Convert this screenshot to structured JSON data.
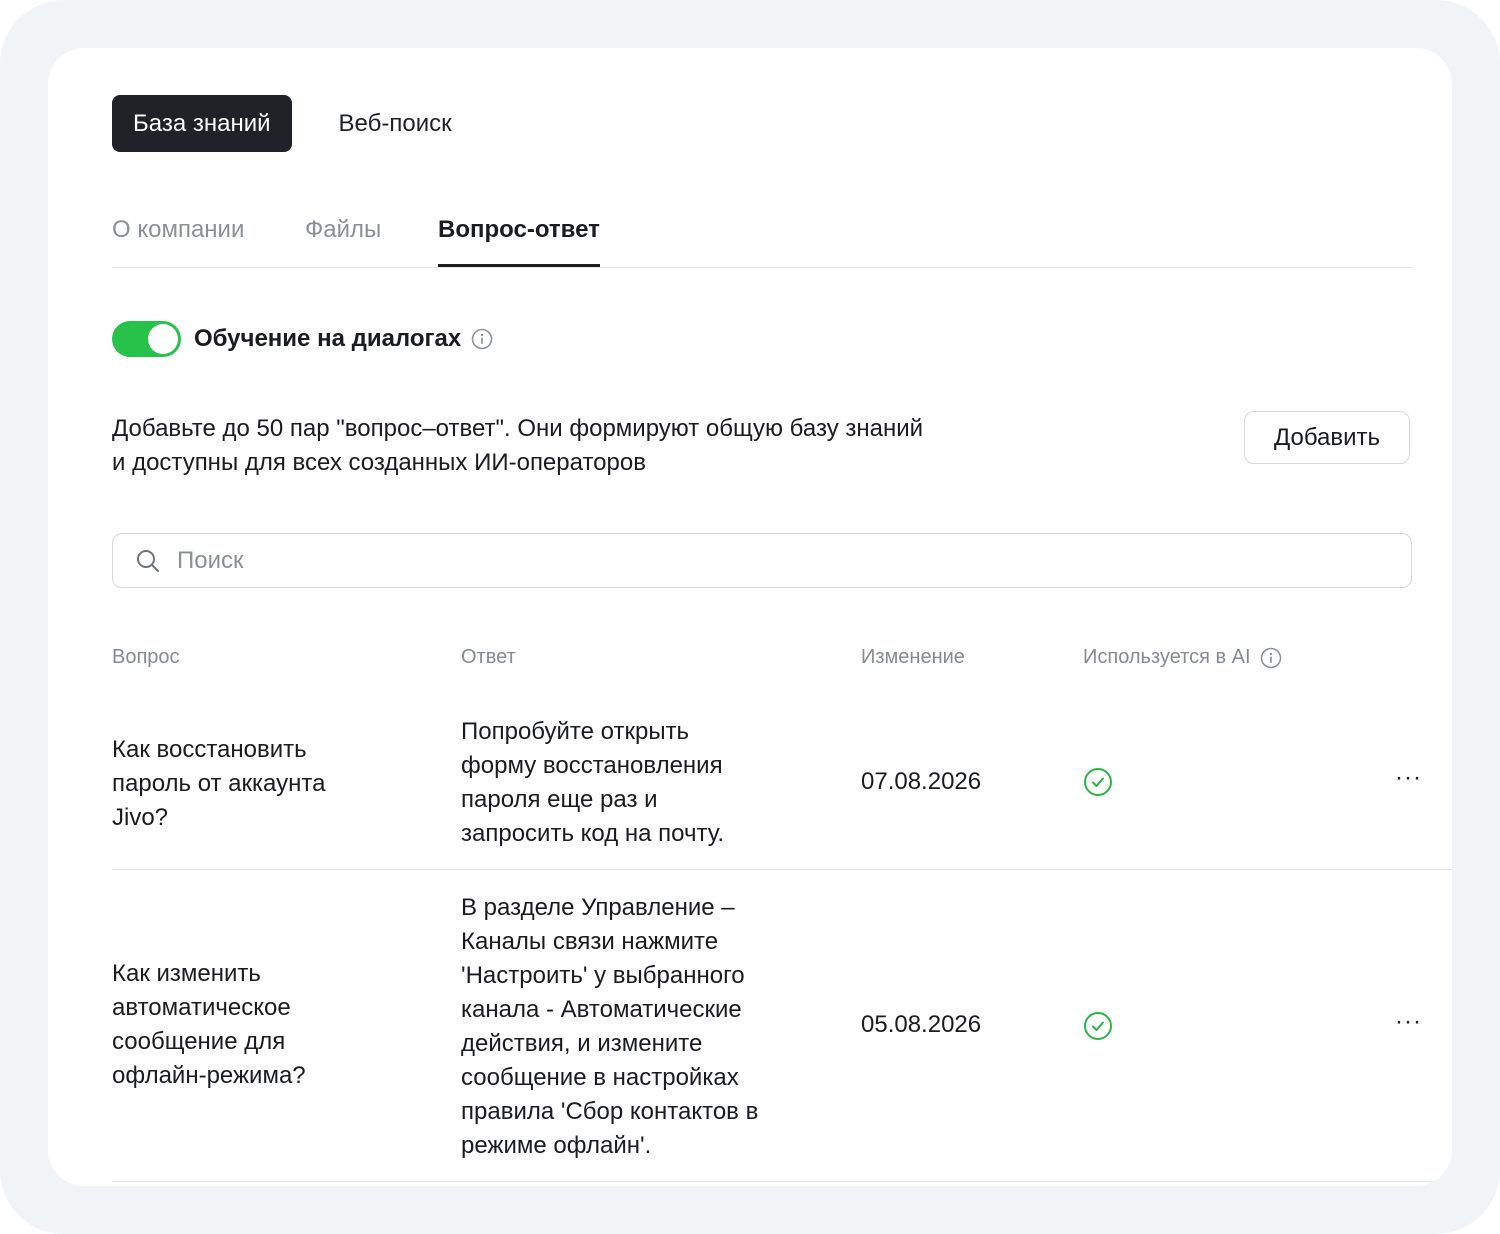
{
  "top_tabs": [
    {
      "label": "База знаний",
      "active": true
    },
    {
      "label": "Веб-поиск",
      "active": false
    }
  ],
  "sub_tabs": [
    {
      "label": "О компании",
      "active": false
    },
    {
      "label": "Файлы",
      "active": false
    },
    {
      "label": "Вопрос-ответ",
      "active": true
    }
  ],
  "training": {
    "label": "Обучение на диалогах",
    "enabled": true
  },
  "description": {
    "line1": "Добавьте до 50 пар \"вопрос–ответ\". Они формируют общую базу знаний",
    "line2": "и доступны для всех созданных ИИ-операторов"
  },
  "add_button": "Добавить",
  "search": {
    "placeholder": "Поиск",
    "value": ""
  },
  "table": {
    "headers": {
      "question": "Вопрос",
      "answer": "Ответ",
      "changed": "Изменение",
      "used_in_ai": "Используется в AI"
    },
    "rows": [
      {
        "question_lines": [
          "Как восстановить",
          "пароль от аккаунта",
          "Jivo?"
        ],
        "answer_lines": [
          "Попробуйте открыть",
          "форму восстановления",
          "пароля еще раз и",
          "запросить код на почту."
        ],
        "changed": "07.08.2026",
        "used_in_ai": true
      },
      {
        "question_lines": [
          "Как изменить",
          "автоматическое",
          "сообщение для",
          "офлайн-режима?"
        ],
        "answer_lines": [
          "В разделе Управление –",
          "Каналы связи нажмите",
          "'Настроить' у выбранного",
          "канала - Автоматические",
          "действия, и измените",
          "сообщение в настройках",
          "правила 'Сбор контактов в",
          "режиме офлайн'."
        ],
        "changed": "05.08.2026",
        "used_in_ai": true
      }
    ]
  },
  "row_menu_label": "···",
  "colors": {
    "toggle_on": "#26c24a",
    "check": "#27b845",
    "active_tab": "#1f2327",
    "muted": "#8b9097"
  }
}
